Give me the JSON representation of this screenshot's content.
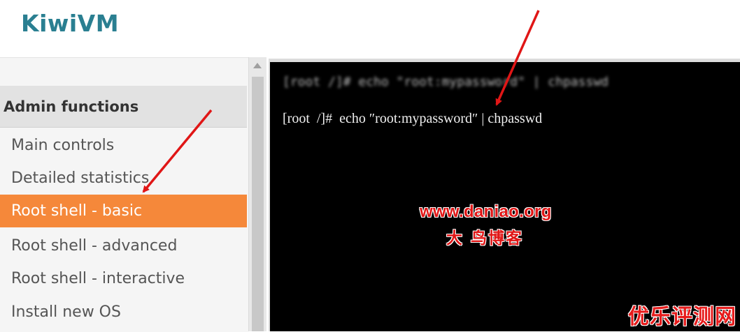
{
  "header": {
    "logo_text": "KiwiVM"
  },
  "sidebar": {
    "section_title": "Admin functions",
    "items": [
      {
        "label": "Main controls",
        "active": false
      },
      {
        "label": "Detailed statistics",
        "active": false
      },
      {
        "label": "Root shell - basic",
        "active": true
      },
      {
        "label": "Root shell - advanced",
        "active": false
      },
      {
        "label": "Root shell - interactive",
        "active": false
      },
      {
        "label": "Install new OS",
        "active": false
      }
    ]
  },
  "terminal": {
    "blurred_line": "[root /]# echo \"root:mypassword\" | chpasswd",
    "command": "[root  /]#  echo ″root:mypassword″ | chpasswd"
  },
  "watermark": {
    "url": "www.daniao.org",
    "cn": "大 鸟博客",
    "corner": "优乐评测网"
  },
  "colors": {
    "accent": "#f5883a",
    "logo": "#2a7f91",
    "annotation_arrow": "#e01616",
    "terminal_bg": "#000000"
  }
}
